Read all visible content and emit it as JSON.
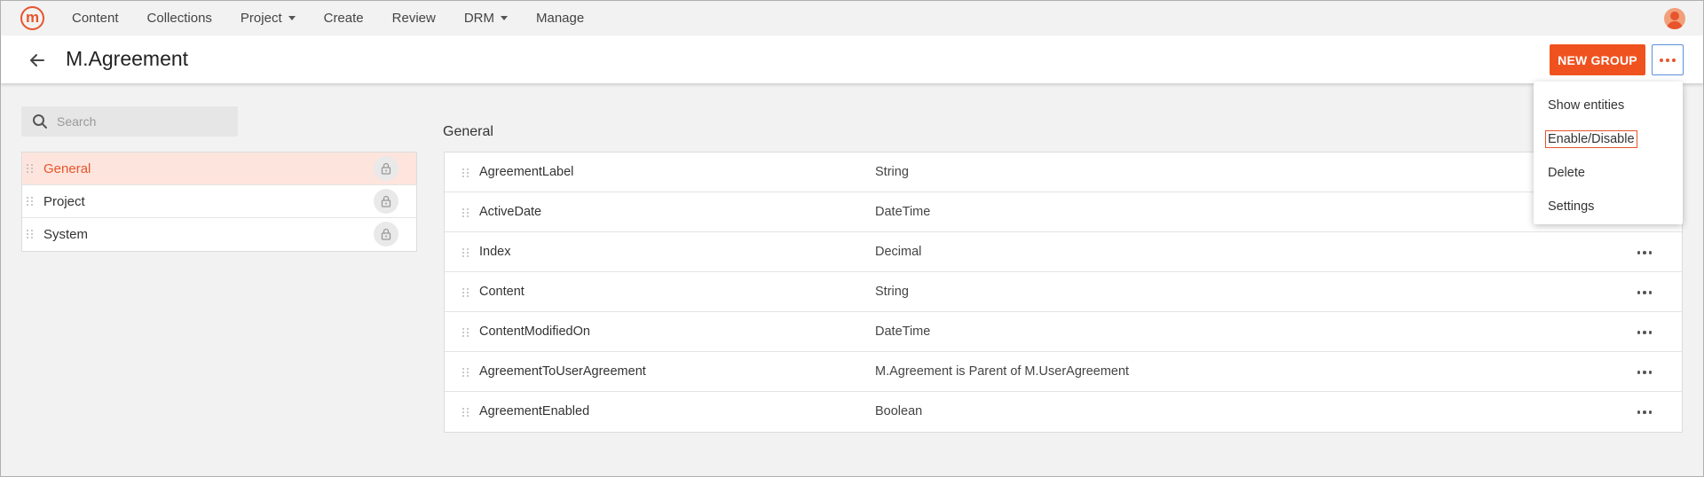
{
  "nav": {
    "logo": "m",
    "items": [
      {
        "label": "Content",
        "dropdown": false
      },
      {
        "label": "Collections",
        "dropdown": false
      },
      {
        "label": "Project",
        "dropdown": true
      },
      {
        "label": "Create",
        "dropdown": false
      },
      {
        "label": "Review",
        "dropdown": false
      },
      {
        "label": "DRM",
        "dropdown": true
      },
      {
        "label": "Manage",
        "dropdown": false
      }
    ]
  },
  "header": {
    "title": "M.Agreement",
    "new_group_label": "NEW GROUP"
  },
  "search": {
    "placeholder": "Search",
    "value": ""
  },
  "groups": [
    {
      "label": "General",
      "active": true
    },
    {
      "label": "Project",
      "active": false
    },
    {
      "label": "System",
      "active": false
    }
  ],
  "section": {
    "title": "General"
  },
  "properties": [
    {
      "name": "AgreementLabel",
      "type": "String"
    },
    {
      "name": "ActiveDate",
      "type": "DateTime"
    },
    {
      "name": "Index",
      "type": "Decimal"
    },
    {
      "name": "Content",
      "type": "String"
    },
    {
      "name": "ContentModifiedOn",
      "type": "DateTime"
    },
    {
      "name": "AgreementToUserAgreement",
      "type": "M.Agreement is Parent of M.UserAgreement"
    },
    {
      "name": "AgreementEnabled",
      "type": "Boolean"
    }
  ],
  "menu": {
    "items": [
      "Show entities",
      "Enable/Disable",
      "Delete",
      "Settings"
    ],
    "focused_item": "Enable/Disable"
  },
  "colors": {
    "accent": "#f0521f",
    "active_row_bg": "#fde5dd",
    "focus_outline": "#5b8fd9"
  },
  "icons": {
    "logo": "brand-logo-m",
    "user": "user-avatar-icon",
    "back": "arrow-left-icon",
    "more": "ellipsis-icon",
    "search": "search-icon",
    "lock": "lock-icon",
    "drag": "drag-handle-icon"
  }
}
